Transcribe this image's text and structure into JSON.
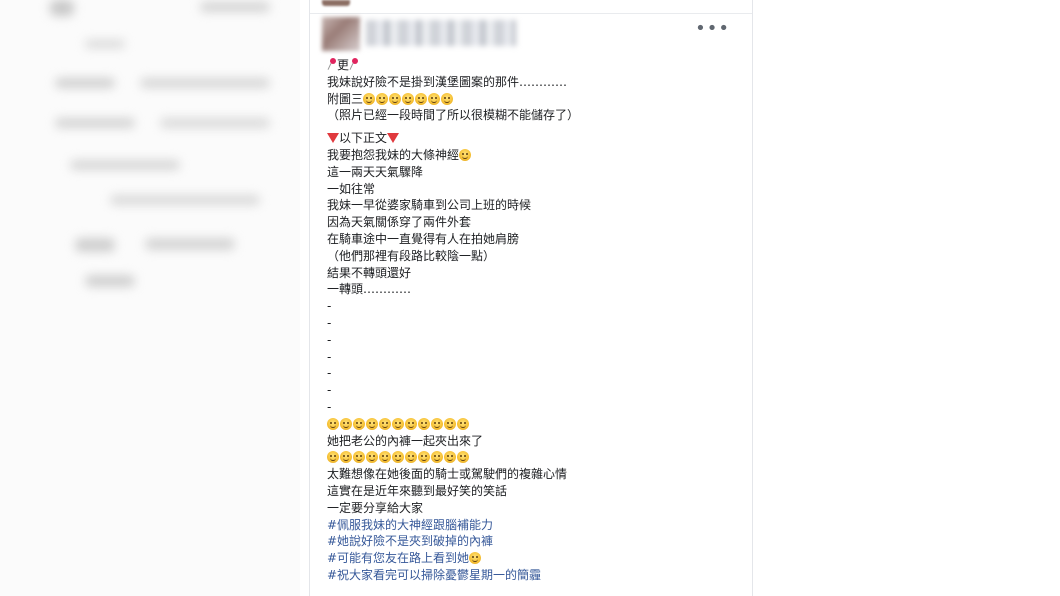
{
  "post": {
    "more_label": "•••",
    "lines": [
      {
        "pre_icon": "pin",
        "text": "更",
        "post_icon": "pin"
      },
      {
        "text": "我妹說好險不是掛到漢堡圖案的那件…………"
      },
      {
        "text": "附圖三",
        "emoji_after": 7
      },
      {
        "text": "（照片已經一段時間了所以很模糊不能儲存了）"
      },
      {
        "gap": true
      },
      {
        "pre_icon": "tri",
        "text": "以下正文",
        "post_icon": "tri"
      },
      {
        "text": "我要抱怨我妹的大條神經",
        "emoji_after": 1
      },
      {
        "text": "這一兩天天氣驟降"
      },
      {
        "text": "一如往常"
      },
      {
        "text": "我妹一早從婆家騎車到公司上班的時候"
      },
      {
        "text": "因為天氣關係穿了兩件外套"
      },
      {
        "text": "在騎車途中一直覺得有人在拍她肩膀"
      },
      {
        "text": "（他們那裡有段路比較陰一點）"
      },
      {
        "text": "結果不轉頭還好"
      },
      {
        "text": "一轉頭…………"
      },
      {
        "text": "-"
      },
      {
        "text": "-"
      },
      {
        "text": "-"
      },
      {
        "text": "-"
      },
      {
        "text": "-"
      },
      {
        "text": "-"
      },
      {
        "text": "-"
      },
      {
        "text": "",
        "emoji_after": 11
      },
      {
        "text": "她把老公的內褲一起夾出來了"
      },
      {
        "text": "",
        "emoji_after": 11
      },
      {
        "text": "太難想像在她後面的騎士或駕駛們的複雜心情"
      },
      {
        "text": "這實在是近年來聽到最好笑的笑話"
      },
      {
        "text": "一定要分享給大家"
      },
      {
        "text": "#佩服我妹的大神經跟腦補能力",
        "tag": true
      },
      {
        "text": "#她說好險不是夾到破掉的內褲",
        "tag": true
      },
      {
        "text": "#可能有您友在路上看到她",
        "tag": true,
        "emoji_after": 1
      },
      {
        "text": "#祝大家看完可以掃除憂鬱星期一的簡霾",
        "tag": true
      }
    ]
  },
  "colors": {
    "text": "#1c1e21",
    "hashtag": "#365899",
    "accent_red": "#e0245e"
  }
}
